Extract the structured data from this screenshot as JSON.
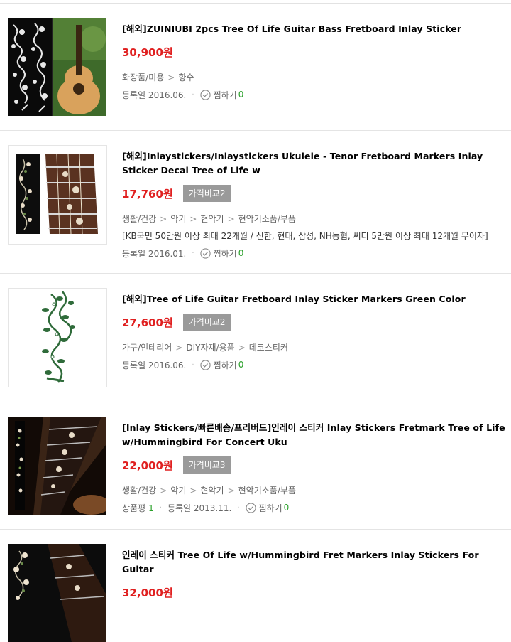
{
  "items": [
    {
      "title": "[해외]ZUINIUBI 2pcs Tree Of Life Guitar Bass Fretboard Inlay Sticker",
      "price": "30,900원",
      "category": [
        "화장품/미용",
        "향수"
      ],
      "reg_label": "등록일 2016.06.",
      "wish_label": "찜하기",
      "wish_count": "0",
      "image": "guitar-sticker-dark-photo"
    },
    {
      "title": "[해외]Inlaystickers/Inlaystickers Ukulele - Tenor Fretboard Markers Inlay Sticker Decal Tree of Life w",
      "price": "17,760원",
      "compare": "가격비교2",
      "category": [
        "생활/건강",
        "악기",
        "현악기",
        "현악기소품/부품"
      ],
      "card_promo": "[KB국민 50만원 이상 최대 22개월 / 신한, 현대, 삼성, NH농협, 씨티 5만원 이상 최대 12개월 무이자]",
      "reg_label": "등록일 2016.01.",
      "wish_label": "찜하기",
      "wish_count": "0",
      "image": "ukulele-fretboard-photo"
    },
    {
      "title": "[해외]Tree of Life Guitar Fretboard Inlay Sticker Markers Green Color",
      "price": "27,600원",
      "compare": "가격비교2",
      "category": [
        "가구/인테리어",
        "DIY자재/용품",
        "데코스티커"
      ],
      "reg_label": "등록일 2016.06.",
      "wish_label": "찜하기",
      "wish_count": "0",
      "image": "green-vine-sticker"
    },
    {
      "title": "[Inlay Stickers/빠른배송/프리버드]인레이 스티커 Inlay Stickers Fretmark Tree of Life w/Hummingbird For Concert Uku",
      "price": "22,000원",
      "compare": "가격비교3",
      "category": [
        "생활/건강",
        "악기",
        "현악기",
        "현악기소품/부품"
      ],
      "review_label": "상품평",
      "review_count": "1",
      "reg_label": "등록일 2013.11.",
      "wish_label": "찜하기",
      "wish_count": "0",
      "image": "guitar-neck-photo"
    },
    {
      "title": "인레이 스티커 Tree Of Life w/Hummingbird Fret Markers Inlay Stickers For Guitar",
      "price": "32,000원",
      "image": "hummingbird-fretboard-photo"
    }
  ],
  "colors": {
    "price": "#e02020",
    "count": "#2aa02a",
    "compare_bg": "#9a9a9a"
  }
}
